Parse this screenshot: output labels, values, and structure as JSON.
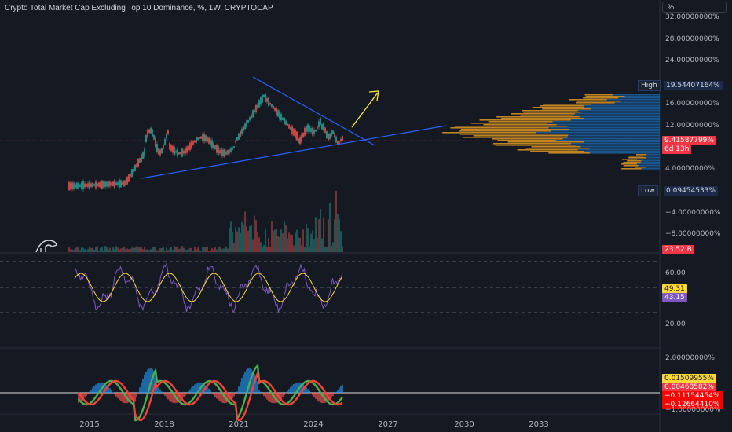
{
  "header": {
    "title": "Crypto Total Market Cap Excluding Top 10 Dominance, %, 1W, CRYPTOCAP",
    "scale_mode": "%"
  },
  "price_axis": {
    "labels": [
      "32.00000000%",
      "28.00000000%",
      "24.00000000%",
      "16.00000000%",
      "12.00000000%",
      "4.00000000%",
      "−4.00000000%",
      "−8.00000000%"
    ]
  },
  "price_panel": {
    "high_label": "High",
    "high_value": "19.54407164%",
    "low_label": "Low",
    "low_value": "0.09454533%",
    "last_price": "9.41587799%",
    "countdown": "6d 13h",
    "volume": "23.52 B"
  },
  "oscillator_panel": {
    "axis_labels": [
      "60.00",
      "20.00"
    ],
    "value_yellow": "49.31",
    "value_purple": "43.15"
  },
  "macd_panel": {
    "axis_labels": [
      "2.00000000%",
      "−1.00000000%"
    ],
    "values": [
      "0.01509955%",
      "0.00468582%",
      "−0.11154454%",
      "−0.12664410%"
    ]
  },
  "time_axis": {
    "labels": [
      "2015",
      "2018",
      "2021",
      "2024",
      "2027",
      "2030",
      "2033"
    ]
  },
  "colors": {
    "background": "#151922",
    "bull": "#26a69a",
    "bear": "#ef5350",
    "trendline": "#2962ff",
    "arrow": "#ffeb3b",
    "rsi": "#7e57c2",
    "rsi_ma": "#fdd835",
    "volume_profile_up": "#1e88e5",
    "volume_profile_down": "#f9a825"
  },
  "icons": {
    "watermark": "tradingview-dino-icon"
  }
}
